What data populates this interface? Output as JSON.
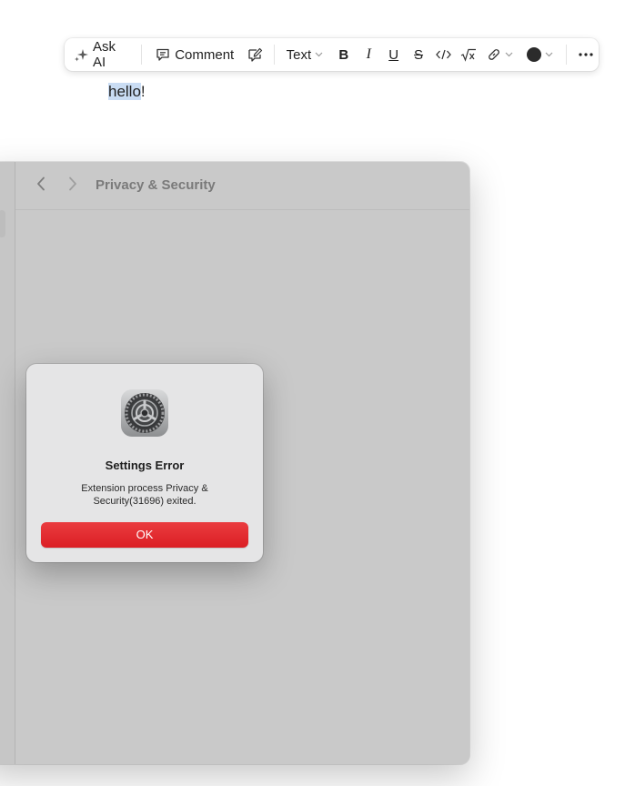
{
  "toolbar": {
    "ask_ai_label": "Ask AI",
    "comment_label": "Comment",
    "text_style_label": "Text",
    "bold_label": "B",
    "italic_label": "I",
    "underline_label": "U",
    "strike_label": "S",
    "text_color": "#2b2b2b"
  },
  "document": {
    "selected_text": "hello",
    "rest_text": "!"
  },
  "settings_window": {
    "title": "Privacy & Security"
  },
  "alert": {
    "title": "Settings Error",
    "message": "Extension process Privacy & Security(31696) exited.",
    "ok_label": "OK",
    "button_color": "#e0262b"
  }
}
